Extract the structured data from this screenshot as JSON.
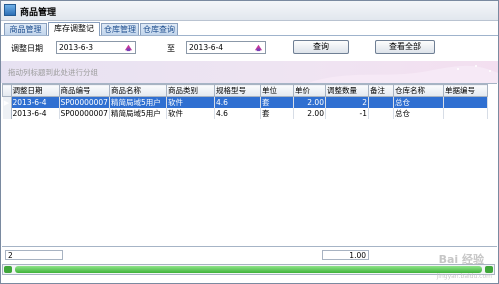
{
  "window": {
    "title": "商品管理"
  },
  "tabs": [
    {
      "label": "商品管理",
      "active": false
    },
    {
      "label": "库存调整记录",
      "active": true
    },
    {
      "label": "仓库管理",
      "active": false
    },
    {
      "label": "仓库查询",
      "active": false
    }
  ],
  "filter": {
    "date_label": "调整日期",
    "from_date": "2013-6-3",
    "to_label": "至",
    "to_date": "2013-6-4",
    "query_button": "查询",
    "view_all_button": "查看全部"
  },
  "group_panel": {
    "hint": "拖动列标题到此处进行分组"
  },
  "grid": {
    "columns": [
      "调整日期",
      "商品编号",
      "商品名称",
      "商品类别",
      "规格型号",
      "单位",
      "单价",
      "调整数量",
      "备注",
      "仓库名称",
      "单据编号"
    ],
    "rows": [
      [
        "2013-6-4",
        "SP00000007",
        "精简局域5用户",
        "软件",
        "4.6",
        "套",
        "2.00",
        "2",
        "",
        "总仓",
        ""
      ],
      [
        "2013-6-4",
        "SP00000007",
        "精简局域5用户",
        "软件",
        "4.6",
        "套",
        "2.00",
        "-1",
        "",
        "总仓",
        ""
      ]
    ],
    "selected_row": 0
  },
  "footer": {
    "count": "2",
    "sum": "1.00"
  },
  "watermark": {
    "text": "Bai 经验",
    "url": "jingyan.baidu.com"
  },
  "colors": {
    "selection": "#2f6fd1",
    "tab_text": "#1f4f8f",
    "scroll": "#3fb33a"
  }
}
